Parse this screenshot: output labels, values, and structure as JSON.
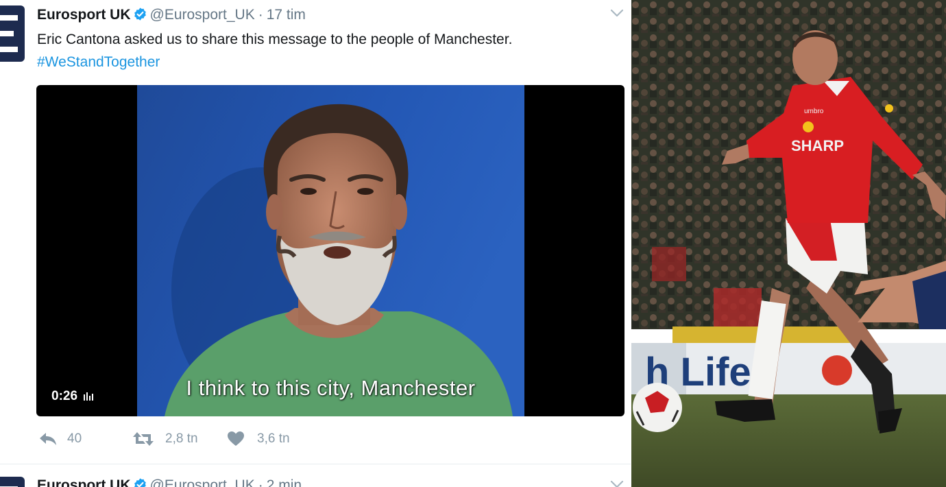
{
  "tweets": [
    {
      "author_name": "Eurosport UK",
      "handle": "@Eurosport_UK",
      "separator": "·",
      "time": "17 tim",
      "text": "Eric Cantona asked us to share this message to the people of Manchester.",
      "hashtag": "#WeStandTogether",
      "video": {
        "subtitle": "I think to this city, Manchester",
        "duration": "0:26"
      },
      "actions": {
        "replies": "40",
        "retweets": "2,8 tn",
        "likes": "3,6 tn"
      }
    },
    {
      "author_name": "Eurosport UK",
      "handle": "@Eurosport_UK",
      "separator": "·",
      "time": "2 min"
    }
  ],
  "photo": {
    "shirt_sponsor": "SHARP",
    "shirt_brand": "umbro",
    "board_text": "h Life"
  },
  "colors": {
    "link": "#1b95e0",
    "verified": "#1da1f2",
    "muted": "#657786",
    "action_icon": "#8899a6",
    "avatar": "#1d2b4f",
    "video_backdrop": "#1f4fa3",
    "jersey": "#d81e22"
  }
}
